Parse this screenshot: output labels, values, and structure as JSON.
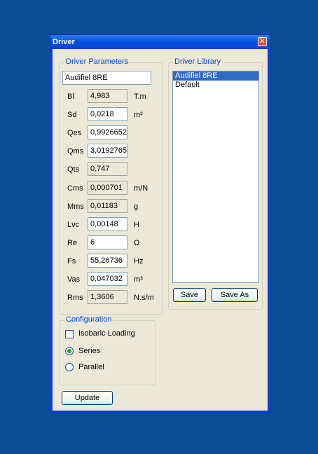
{
  "window": {
    "title": "Driver"
  },
  "driver_parameters": {
    "group_title": "Driver Parameters",
    "name_value": "Audifiel 8RE",
    "params": [
      {
        "label": "Bl",
        "value": "4,983",
        "unit": "T.m",
        "readonly": true
      },
      {
        "label": "Sd",
        "value": "0,0218",
        "unit": "m²",
        "readonly": false
      },
      {
        "label": "Qes",
        "value": "0,9926652",
        "unit": "",
        "readonly": false
      },
      {
        "label": "Qms",
        "value": "3,0192765",
        "unit": "",
        "readonly": false
      },
      {
        "label": "Qts",
        "value": "0,747",
        "unit": "",
        "readonly": true
      },
      {
        "label": "Cms",
        "value": "0,000701",
        "unit": "m/N",
        "readonly": true
      },
      {
        "label": "Mms",
        "value": "0,01183",
        "unit": "g",
        "readonly": true
      },
      {
        "label": "Lvc",
        "value": "0,00148",
        "unit": "H",
        "readonly": false
      },
      {
        "label": "Re",
        "value": "6",
        "unit": "Ω",
        "readonly": false
      },
      {
        "label": "Fs",
        "value": "55,26736",
        "unit": "Hz",
        "readonly": false
      },
      {
        "label": "Vas",
        "value": "0,047032",
        "unit": "m³",
        "readonly": false
      },
      {
        "label": "Rms",
        "value": "1,3606",
        "unit": "N.s/m",
        "readonly": true
      }
    ]
  },
  "driver_library": {
    "group_title": "Driver Library",
    "items": [
      {
        "label": "Audifiel 8RE",
        "selected": true
      },
      {
        "label": "Default",
        "selected": false
      }
    ],
    "save_label": "Save",
    "save_as_label": "Save As"
  },
  "configuration": {
    "group_title": "Configuration",
    "isobaric_label": "Isobaric Loading",
    "isobaric_checked": false,
    "series_label": "Series",
    "parallel_label": "Parallel",
    "selected": "series"
  },
  "update_label": "Update"
}
